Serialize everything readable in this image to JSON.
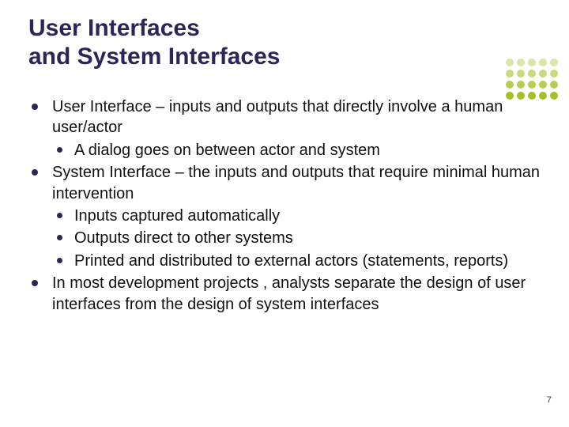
{
  "title_line1": "User Interfaces",
  "title_line2": "and System Interfaces",
  "bullets": [
    {
      "text": "User Interface – inputs and outputs that directly involve a human user/actor",
      "sub": [
        "A dialog goes on between actor and system"
      ]
    },
    {
      "text": "System Interface – the inputs and outputs that require minimal human intervention",
      "sub": [
        "Inputs captured automatically",
        "Outputs direct to other systems",
        "Printed and distributed to external actors (statements, reports)"
      ]
    },
    {
      "text": "In most development projects , analysts separate the design of user interfaces from the design of system interfaces",
      "sub": []
    }
  ],
  "page_number": "7",
  "decor_colors": [
    "#d9e6a8",
    "#d9e6a8",
    "#d9e6a8",
    "#d9e6a8",
    "#d9e6a8",
    "#c9da7d",
    "#c9da7d",
    "#c9da7d",
    "#c9da7d",
    "#c9da7d",
    "#b8cd52",
    "#b8cd52",
    "#b8cd52",
    "#b8cd52",
    "#b8cd52",
    "#a7c027",
    "#a7c027",
    "#a7c027",
    "#a7c027",
    "#a7c027"
  ]
}
